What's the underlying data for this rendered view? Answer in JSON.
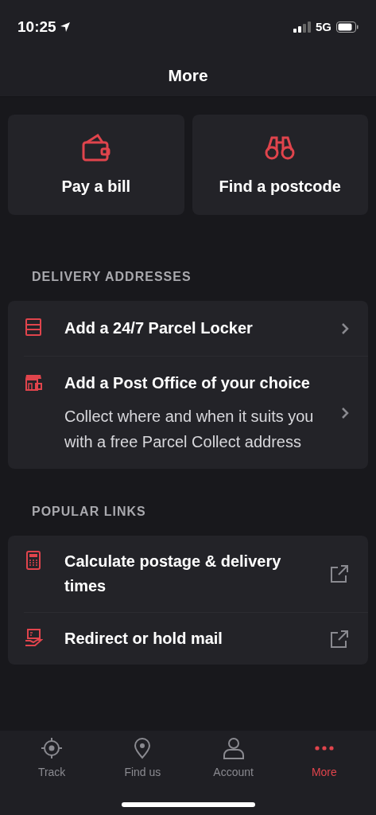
{
  "status_bar": {
    "time": "10:25",
    "network": "5G"
  },
  "header": {
    "title": "More"
  },
  "quick_actions": [
    {
      "label": "Pay a bill"
    },
    {
      "label": "Find a postcode"
    }
  ],
  "sections": [
    {
      "heading": "DELIVERY ADDRESSES",
      "items": [
        {
          "title": "Add a 24/7 Parcel Locker",
          "kind": "internal"
        },
        {
          "title": "Add a Post Office of your choice",
          "description": "Collect where and when it suits you with a free Parcel Collect address",
          "kind": "internal"
        }
      ]
    },
    {
      "heading": "POPULAR LINKS",
      "items": [
        {
          "title": "Calculate postage & delivery times",
          "kind": "external"
        },
        {
          "title": "Redirect or hold mail",
          "kind": "external"
        }
      ]
    }
  ],
  "tab_bar": [
    {
      "label": "Track",
      "selected": false
    },
    {
      "label": "Find us",
      "selected": false
    },
    {
      "label": "Account",
      "selected": false
    },
    {
      "label": "More",
      "selected": true
    }
  ]
}
